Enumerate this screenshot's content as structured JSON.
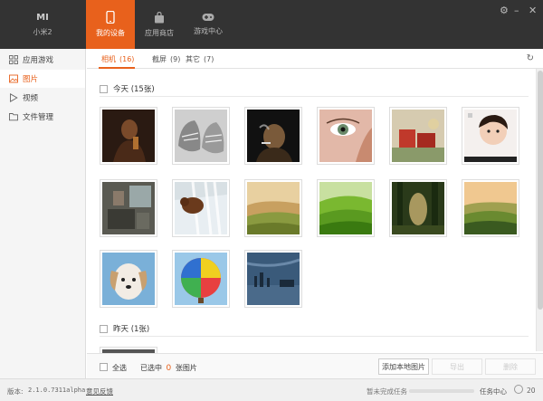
{
  "header": {
    "nav": [
      {
        "label": "小米2",
        "icon": "mi-logo-icon"
      },
      {
        "label": "我的设备",
        "icon": "phone-icon"
      },
      {
        "label": "应用商店",
        "icon": "shopping-bag-icon"
      },
      {
        "label": "游戏中心",
        "icon": "gamepad-icon"
      }
    ],
    "mi_logo": "MI",
    "window_controls": [
      "gear-icon",
      "minimize-icon",
      "close-icon"
    ]
  },
  "sidebar": {
    "items": [
      {
        "label": "应用游戏",
        "icon": "apps-grid-icon"
      },
      {
        "label": "图片",
        "icon": "image-icon"
      },
      {
        "label": "视频",
        "icon": "play-icon"
      },
      {
        "label": "文件管理",
        "icon": "folder-icon"
      }
    ]
  },
  "tabs": [
    {
      "label": "相机",
      "count": "(16)"
    },
    {
      "label": "截屏",
      "count": "(9)"
    },
    {
      "label": "其它",
      "count": "(7)"
    }
  ],
  "groups": {
    "today": "今天 (15张)",
    "yesterday": "昨天 (1张)"
  },
  "photos": [
    "dark-portrait",
    "worn-sneakers",
    "smoking-man",
    "womans-eye",
    "red-toys",
    "baby",
    "cluttered-room",
    "bear-waterfall",
    "golden-hills",
    "green-hills",
    "misty-forest",
    "sunset-valley",
    "white-puppy",
    "hot-air-balloon",
    "city-skyline"
  ],
  "actionbar": {
    "select_all": "全选",
    "selected_prefix": "已选中",
    "selected_count": "0",
    "selected_suffix": "张图片",
    "add_local": "添加本地图片",
    "export": "导出",
    "delete": "删除"
  },
  "status": {
    "version_label": "版本:",
    "version": "2.1.0.7311alpha",
    "feedback": "意见反馈",
    "tasks_pending": "暂未完成任务",
    "task_center": "任务中心",
    "notifications": "20"
  },
  "colors": {
    "accent": "#e8611c",
    "topbar": "#333333"
  }
}
